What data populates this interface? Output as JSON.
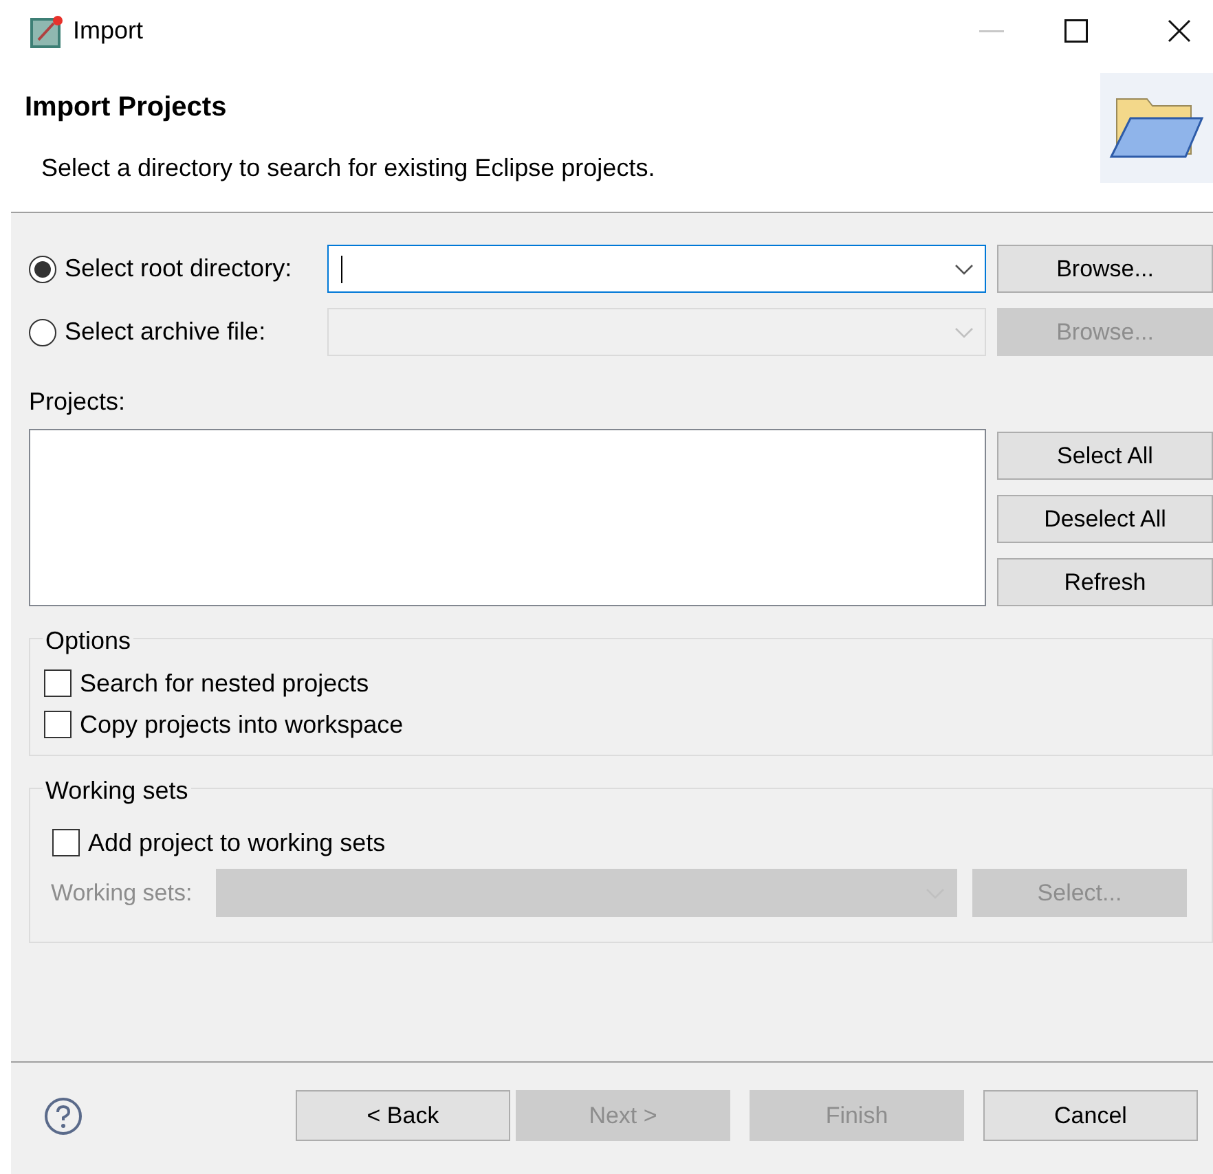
{
  "window": {
    "title": "Import"
  },
  "header": {
    "title": "Import Projects",
    "description": "Select a directory to search for existing Eclipse projects."
  },
  "sources": [
    {
      "label": "Select root directory:",
      "selected": true,
      "disabled": false,
      "focused": true,
      "button": {
        "label": "Browse...",
        "disabled": false
      }
    },
    {
      "label": "Select archive file:",
      "selected": false,
      "disabled": true,
      "focused": false,
      "button": {
        "label": "Browse...",
        "disabled": true
      }
    }
  ],
  "projects": {
    "label": "Projects:",
    "buttons": [
      {
        "label": "Select All",
        "disabled": false
      },
      {
        "label": "Deselect All",
        "disabled": false
      },
      {
        "label": "Refresh",
        "disabled": false
      }
    ]
  },
  "options": {
    "title": "Options",
    "items": [
      {
        "label": "Search for nested projects",
        "checked": false
      },
      {
        "label": "Copy projects into workspace",
        "checked": false
      }
    ]
  },
  "working_sets": {
    "title": "Working sets",
    "checkbox": {
      "label": "Add project to working sets",
      "checked": false
    },
    "field_label": "Working sets:",
    "disabled": true,
    "button": {
      "label": "Select...",
      "disabled": true
    }
  },
  "footer": {
    "buttons": [
      {
        "label": "< Back",
        "disabled": false
      },
      {
        "label": "Next >",
        "disabled": true
      },
      {
        "label": "Finish",
        "disabled": true
      },
      {
        "label": "Cancel",
        "disabled": false
      }
    ]
  }
}
